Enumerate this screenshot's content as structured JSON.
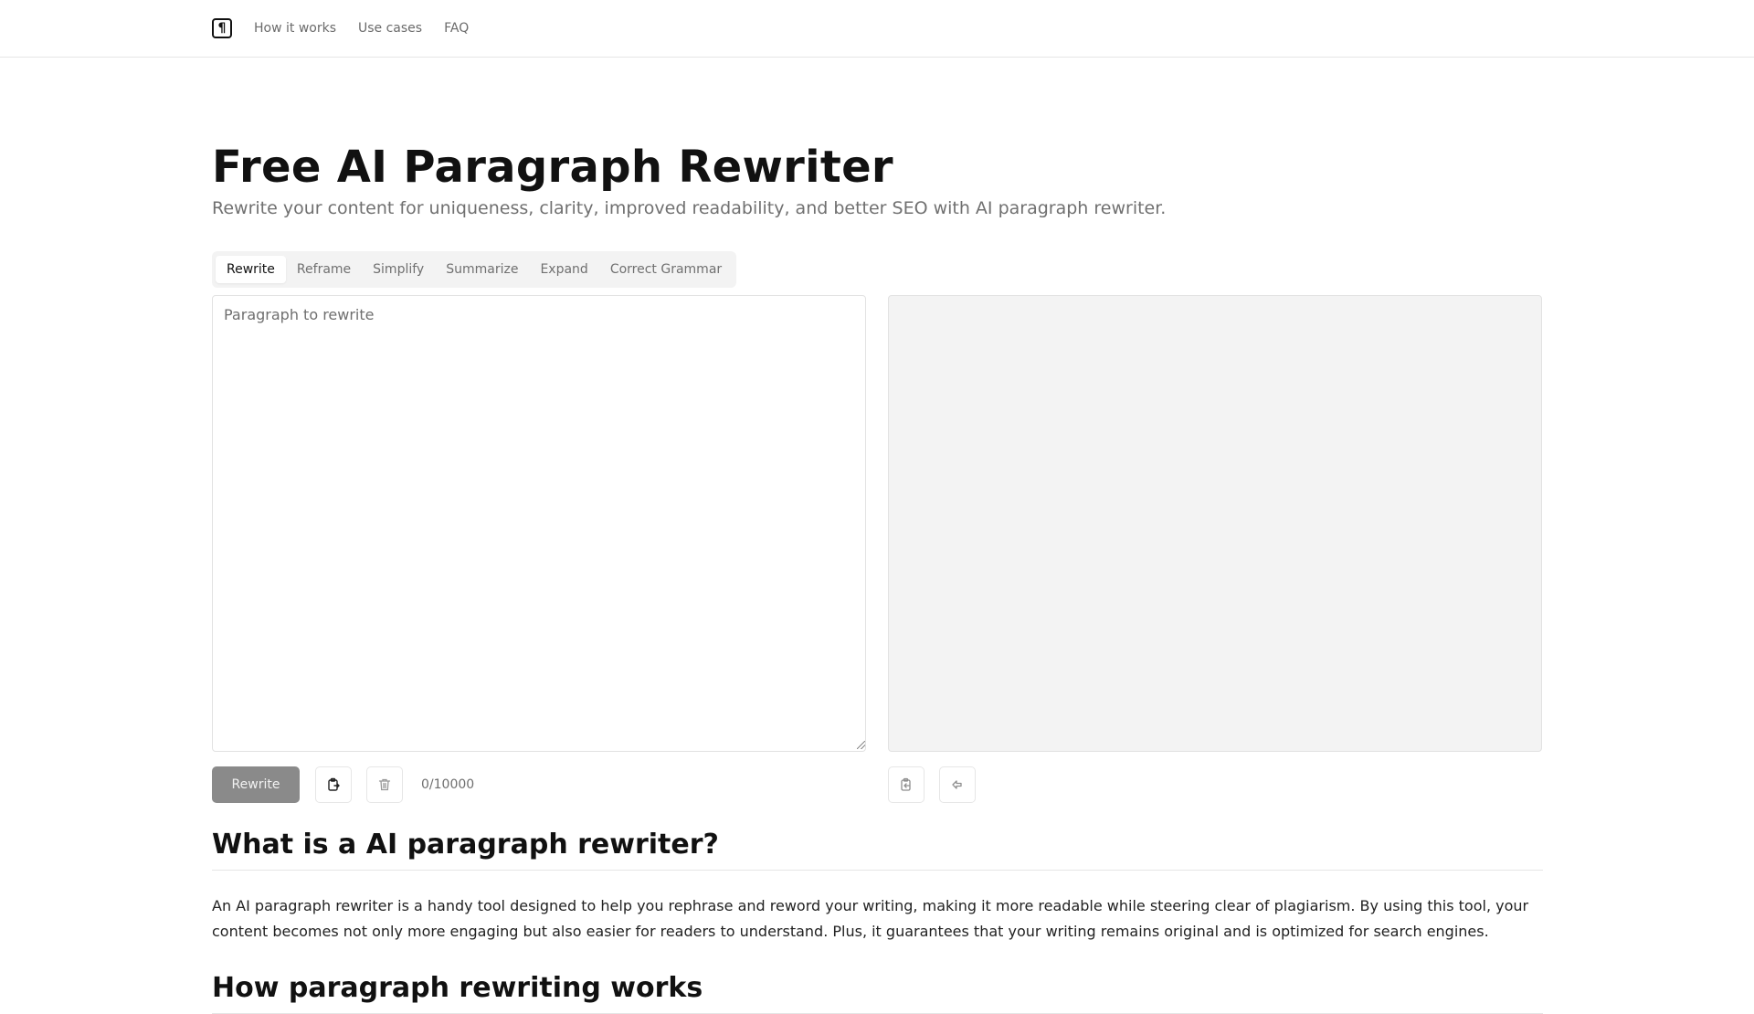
{
  "nav": {
    "logo_icon": "pilcrow-icon",
    "links": [
      "How it works",
      "Use cases",
      "FAQ"
    ]
  },
  "header": {
    "title": "Free AI Paragraph Rewriter",
    "subtitle": "Rewrite your content for uniqueness, clarity, improved readability, and better SEO with AI paragraph rewriter."
  },
  "tabs": [
    {
      "label": "Rewrite",
      "active": true
    },
    {
      "label": "Reframe",
      "active": false
    },
    {
      "label": "Simplify",
      "active": false
    },
    {
      "label": "Summarize",
      "active": false
    },
    {
      "label": "Expand",
      "active": false
    },
    {
      "label": "Correct Grammar",
      "active": false
    }
  ],
  "editor": {
    "input_value": "",
    "input_placeholder": "Paragraph to rewrite",
    "output_value": "",
    "submit_label": "Rewrite",
    "paste_icon": "clipboard-paste-icon",
    "clear_icon": "trash-icon",
    "char_count": "0/10000",
    "copy_icon": "clipboard-copy-icon",
    "move_icon": "arrow-left-icon"
  },
  "content": {
    "section1_heading": "What is a AI paragraph rewriter?",
    "section1_body": "An AI paragraph rewriter is a handy tool designed to help you rephrase and reword your writing, making it more readable while steering clear of plagiarism. By using this tool, your content becomes not only more engaging but also easier for readers to understand. Plus, it guarantees that your writing remains original and is optimized for search engines.",
    "section2_heading": "How paragraph rewriting works"
  },
  "colors": {
    "primary_button": "#8a8a8a",
    "output_bg": "#f3f3f3",
    "tabs_bg": "#f3f3f3",
    "muted_text": "#707070"
  }
}
